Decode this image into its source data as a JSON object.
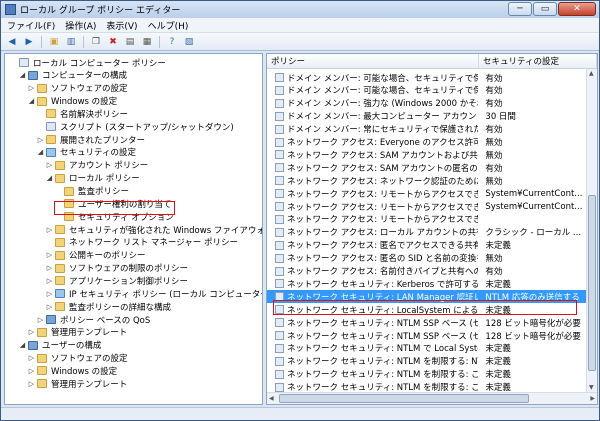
{
  "window": {
    "title": "ローカル グループ ポリシー エディター",
    "min": "─",
    "max": "▭",
    "close": "✕"
  },
  "menu": [
    "ファイル(F)",
    "操作(A)",
    "表示(V)",
    "ヘルプ(H)"
  ],
  "toolbar": [
    "back-icon",
    "forward-icon",
    "up-folder-icon",
    "show-hide-tree-icon",
    "copy-icon",
    "delete-icon",
    "properties-icon",
    "export-icon",
    "help-icon"
  ],
  "tree": [
    {
      "label": "ローカル コンピューター ポリシー",
      "level": 0,
      "tw": "",
      "icon": "pol"
    },
    {
      "label": "コンピューターの構成",
      "level": 1,
      "tw": "◢",
      "icon": "pc"
    },
    {
      "label": "ソフトウェアの設定",
      "level": 2,
      "tw": "▷",
      "icon": "f"
    },
    {
      "label": "Windows の設定",
      "level": 2,
      "tw": "◢",
      "icon": "f"
    },
    {
      "label": "名前解決ポリシー",
      "level": 3,
      "tw": "",
      "icon": "f"
    },
    {
      "label": "スクリプト (スタートアップ/シャットダウン)",
      "level": 3,
      "tw": "",
      "icon": "pol"
    },
    {
      "label": "展開されたプリンター",
      "level": 3,
      "tw": "▷",
      "icon": "f"
    },
    {
      "label": "セキュリティの設定",
      "level": 3,
      "tw": "◢",
      "icon": "sh"
    },
    {
      "label": "アカウント ポリシー",
      "level": 4,
      "tw": "▷",
      "icon": "f"
    },
    {
      "label": "ローカル ポリシー",
      "level": 4,
      "tw": "◢",
      "icon": "f"
    },
    {
      "label": "監査ポリシー",
      "level": 5,
      "tw": "",
      "icon": "f"
    },
    {
      "label": "ユーザー権利の割り当て",
      "level": 5,
      "tw": "",
      "icon": "f"
    },
    {
      "label": "セキュリティ オプション",
      "level": 5,
      "tw": "",
      "icon": "f"
    },
    {
      "label": "セキュリティが強化された Windows ファイアウォール",
      "level": 4,
      "tw": "▷",
      "icon": "f"
    },
    {
      "label": "ネットワーク リスト マネージャー ポリシー",
      "level": 4,
      "tw": "",
      "icon": "f"
    },
    {
      "label": "公開キーのポリシー",
      "level": 4,
      "tw": "▷",
      "icon": "f"
    },
    {
      "label": "ソフトウェアの制限のポリシー",
      "level": 4,
      "tw": "▷",
      "icon": "f"
    },
    {
      "label": "アプリケーション制御ポリシー",
      "level": 4,
      "tw": "▷",
      "icon": "f"
    },
    {
      "label": "IP セキュリティ ポリシー (ローカル コンピューター)",
      "level": 4,
      "tw": "▷",
      "icon": "sh"
    },
    {
      "label": "監査ポリシーの詳細な構成",
      "level": 4,
      "tw": "▷",
      "icon": "f"
    },
    {
      "label": "ポリシー ベースの QoS",
      "level": 3,
      "tw": "▷",
      "icon": "pc"
    },
    {
      "label": "管理用テンプレート",
      "level": 2,
      "tw": "▷",
      "icon": "f"
    },
    {
      "label": "ユーザーの構成",
      "level": 1,
      "tw": "◢",
      "icon": "pc"
    },
    {
      "label": "ソフトウェアの設定",
      "level": 2,
      "tw": "▷",
      "icon": "f"
    },
    {
      "label": "Windows の設定",
      "level": 2,
      "tw": "▷",
      "icon": "f"
    },
    {
      "label": "管理用テンプレート",
      "level": 2,
      "tw": "▷",
      "icon": "f"
    }
  ],
  "list": {
    "headers": [
      "ポリシー",
      "セキュリティの設定"
    ],
    "rows": [
      {
        "name": "ドメイン メンバー: 可能な場合、セキュリティで保護されたチャ...",
        "value": "有効"
      },
      {
        "name": "ドメイン メンバー: 可能な場合、セキュリティで保護されたチャ...",
        "value": "有効"
      },
      {
        "name": "ドメイン メンバー: 強力な (Windows 2000 かそれ以降の) ...",
        "value": "有効"
      },
      {
        "name": "ドメイン メンバー: 最大コンピューター アカウントのパスワード...",
        "value": "30 日間"
      },
      {
        "name": "ドメイン メンバー: 常にセキュリティで保護されたチャネルの...",
        "value": "有効"
      },
      {
        "name": "ネットワーク アクセス: Everyone のアクセス許可を匿名...",
        "value": "無効"
      },
      {
        "name": "ネットワーク アクセス: SAM アカウントおよび共有の匿名...",
        "value": "無効"
      },
      {
        "name": "ネットワーク アクセス: SAM アカウントの匿名の列挙を許...",
        "value": "有効"
      },
      {
        "name": "ネットワーク アクセス: ネットワーク認証のためにパスワー...",
        "value": "無効"
      },
      {
        "name": "ネットワーク アクセス: リモートからアクセスできるレジス...",
        "value": "System¥CurrentCont..."
      },
      {
        "name": "ネットワーク アクセス: リモートからアクセスできるレジス...",
        "value": "System¥CurrentCont..."
      },
      {
        "name": "ネットワーク アクセス: リモートからアクセスできる名前...",
        "value": ""
      },
      {
        "name": "ネットワーク アクセス: ローカル アカウントの共有とセキュ...",
        "value": "クラシック - ローカル ..."
      },
      {
        "name": "ネットワーク アクセス: 匿名でアクセスできる共有",
        "value": "未定義"
      },
      {
        "name": "ネットワーク アクセス: 匿名の SID と名前の変換を許可...",
        "value": "無効"
      },
      {
        "name": "ネットワーク アクセス: 名前付きパイプと共有への匿名の...",
        "value": "有効"
      },
      {
        "name": "ネットワーク セキュリティ: Kerberos で許可する暗号化...",
        "value": "未定義"
      },
      {
        "name": "ネットワーク セキュリティ: LAN Manager 認証レベル",
        "value": "NTLM 応答のみ送信する"
      },
      {
        "name": "ネットワーク セキュリティ: LocalSystem による NULL ...",
        "value": "未定義"
      },
      {
        "name": "ネットワーク セキュリティ: NTLM SSP ベース (セキュア...",
        "value": "128 ビット暗号化が必要"
      },
      {
        "name": "ネットワーク セキュリティ: NTLM SSP ベース (セキュア...",
        "value": "128 ビット暗号化が必要"
      },
      {
        "name": "ネットワーク セキュリティ: NTLM で Local System に...",
        "value": "未定義"
      },
      {
        "name": "ネットワーク セキュリティ: NTLM を制限する: NTLM 認...",
        "value": "未定義"
      },
      {
        "name": "ネットワーク セキュリティ: NTLM を制限する: このドメイ...",
        "value": "未定義"
      },
      {
        "name": "ネットワーク セキュリティ: NTLM を制限する: このドメイ...",
        "value": "未定義"
      }
    ]
  },
  "highlight_color": "#3399ff"
}
